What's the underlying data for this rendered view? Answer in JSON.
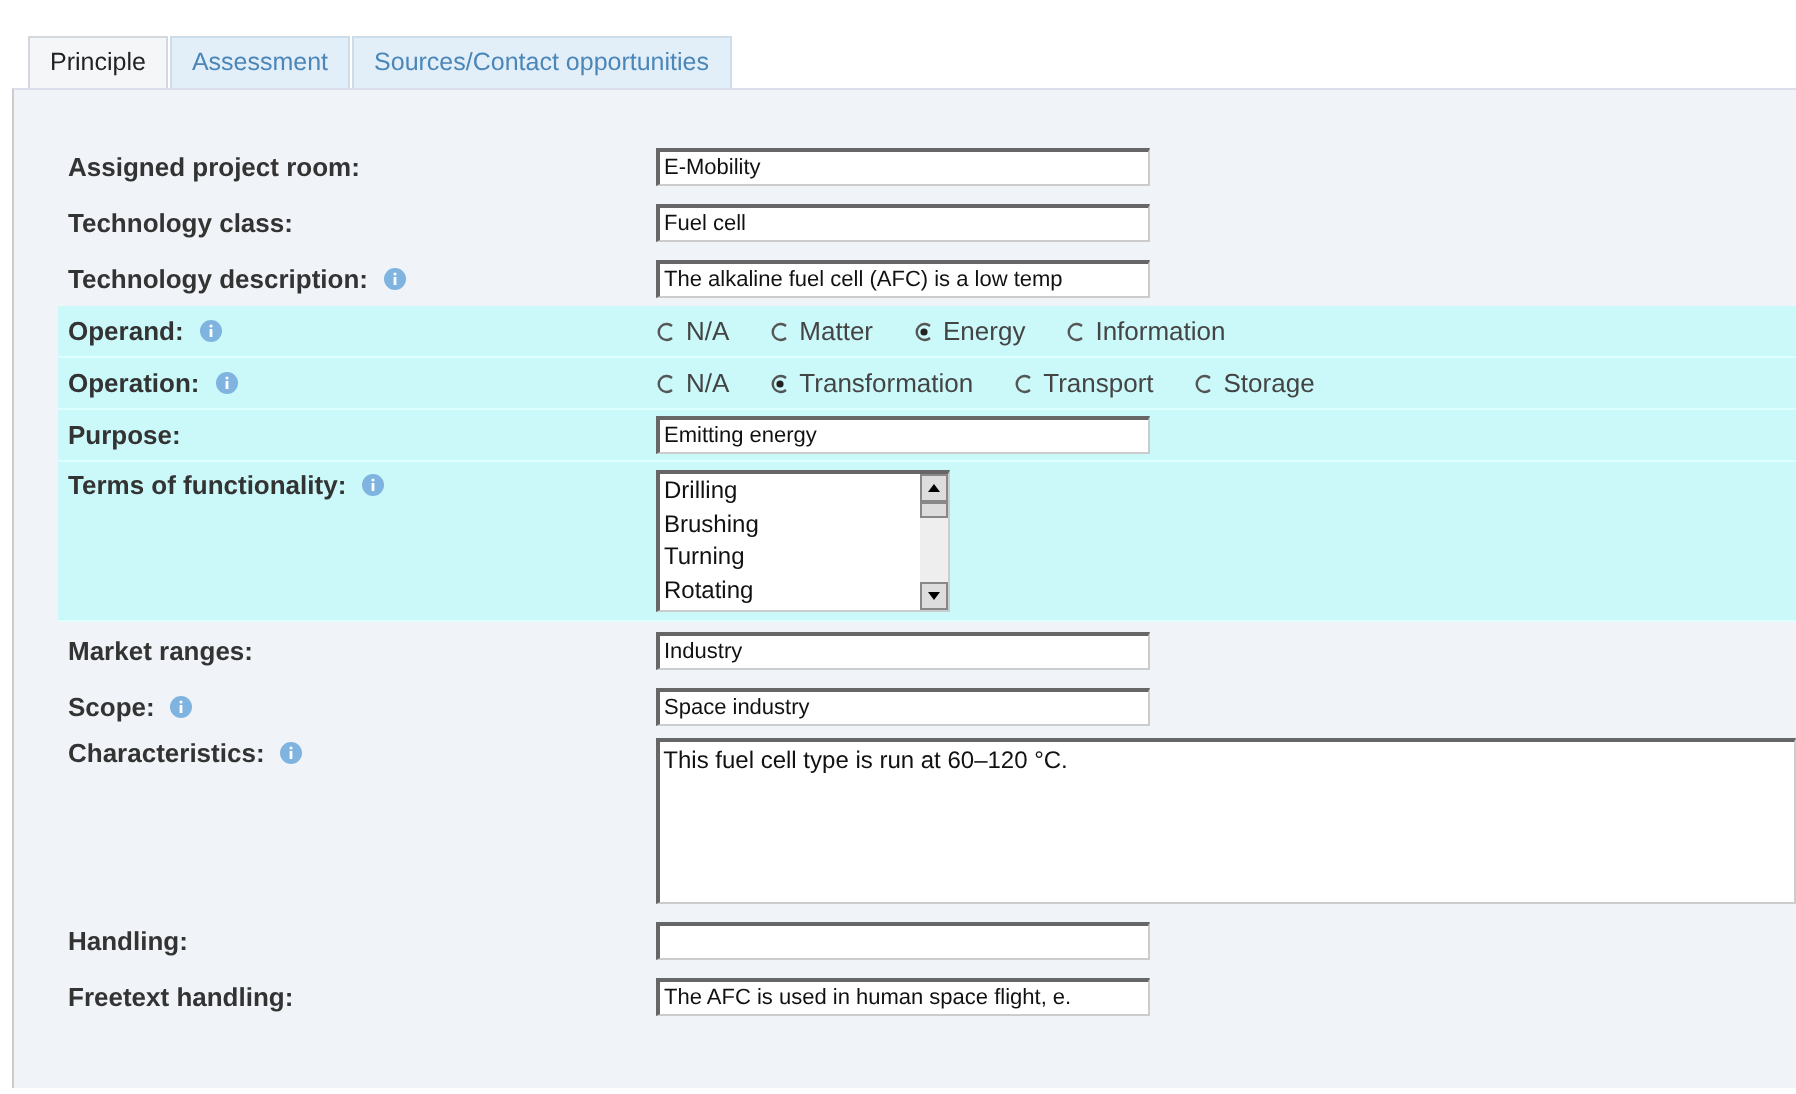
{
  "tabs": [
    {
      "label": "Principle",
      "selected": true
    },
    {
      "label": "Assessment",
      "selected": false
    },
    {
      "label": "Sources/Contact opportunities",
      "selected": false
    }
  ],
  "rows": [
    {
      "kind": "text",
      "label": "Assigned project room:",
      "info": false,
      "highlighted": false,
      "value": "E-Mobility"
    },
    {
      "kind": "text",
      "label": "Technology class:",
      "info": false,
      "highlighted": false,
      "value": "Fuel cell"
    },
    {
      "kind": "text",
      "label": "Technology description:",
      "info": true,
      "highlighted": false,
      "value": "The alkaline fuel cell (AFC) is a low temp"
    },
    {
      "kind": "radio",
      "label": "Operand:",
      "info": true,
      "highlighted": true,
      "options": [
        {
          "label": "N/A",
          "selected": false
        },
        {
          "label": "Matter",
          "selected": false
        },
        {
          "label": "Energy",
          "selected": true
        },
        {
          "label": "Information",
          "selected": false
        }
      ]
    },
    {
      "kind": "radio",
      "label": "Operation:",
      "info": true,
      "highlighted": true,
      "options": [
        {
          "label": "N/A",
          "selected": false
        },
        {
          "label": "Transformation",
          "selected": true
        },
        {
          "label": "Transport",
          "selected": false
        },
        {
          "label": "Storage",
          "selected": false
        }
      ]
    },
    {
      "kind": "text",
      "label": "Purpose:",
      "info": false,
      "highlighted": true,
      "value": "Emitting energy"
    },
    {
      "kind": "list",
      "label": "Terms of functionality:",
      "info": true,
      "highlighted": true,
      "items": [
        "Drilling",
        "Brushing",
        "Turning",
        "Rotating"
      ]
    },
    {
      "kind": "text",
      "label": "Market ranges:",
      "info": false,
      "highlighted": false,
      "value": "Industry"
    },
    {
      "kind": "text",
      "label": "Scope:",
      "info": true,
      "highlighted": false,
      "value": "Space industry"
    },
    {
      "kind": "textarea",
      "label": "Characteristics:",
      "info": true,
      "highlighted": false,
      "value": "This fuel cell type is run at 60–120 °C."
    },
    {
      "kind": "text",
      "label": "Handling:",
      "info": false,
      "highlighted": false
    },
    {
      "kind": "text",
      "label": "Freetext handling:",
      "info": false,
      "highlighted": false,
      "value": "The AFC is used in human space flight, e."
    }
  ]
}
